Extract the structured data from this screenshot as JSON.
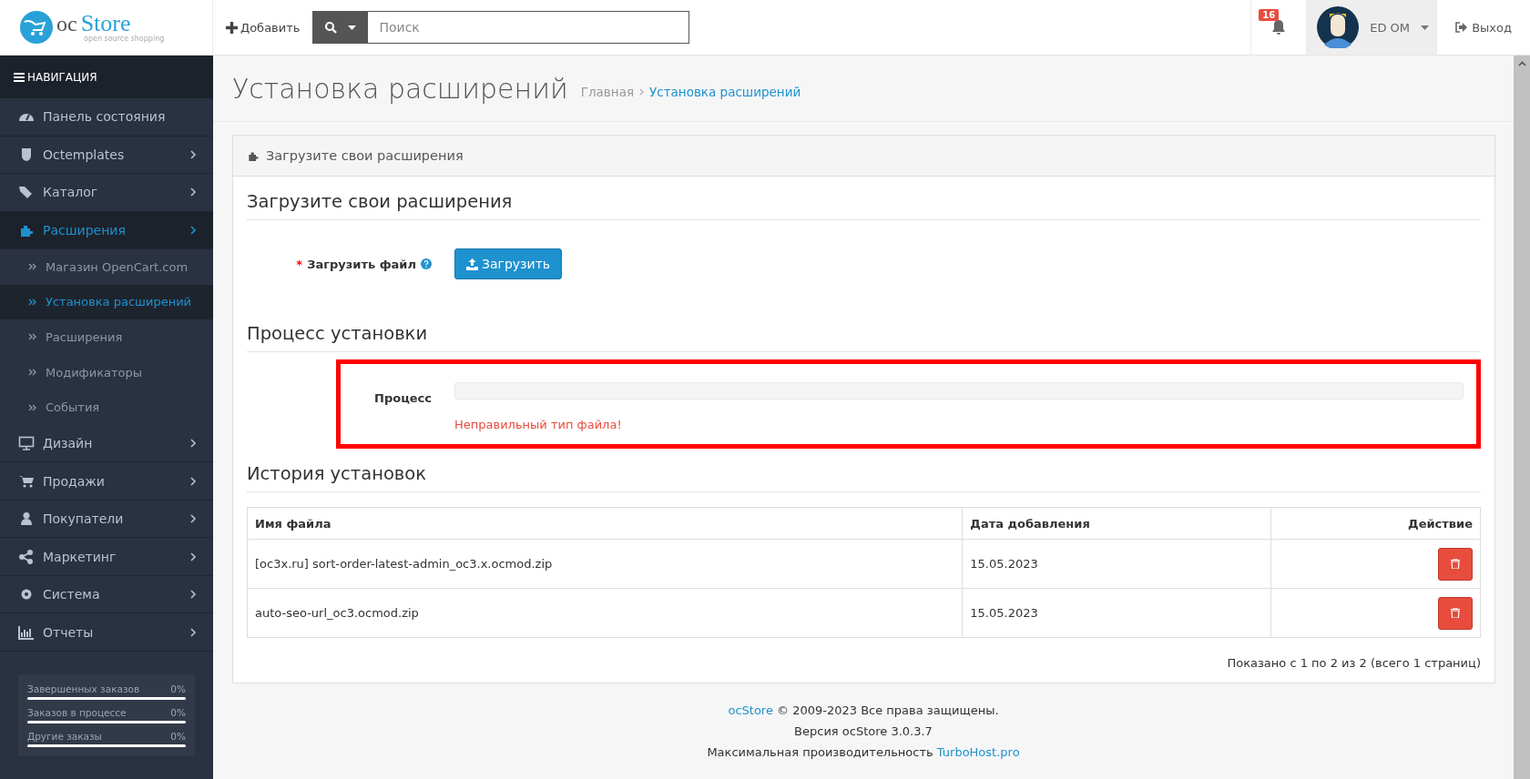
{
  "header": {
    "logo": {
      "text_1": "oc",
      "text_2": "Store",
      "tagline": "open source shopping"
    },
    "add_button": "Добавить",
    "search": {
      "placeholder": "Поиск"
    },
    "notifications": {
      "count": "16"
    },
    "user": {
      "name": "ED OM"
    },
    "logout": "Выход"
  },
  "sidebar": {
    "title": "НАВИГАЦИЯ",
    "items": [
      {
        "label": "Панель состояния",
        "selected": false,
        "has_arrow": false
      },
      {
        "label": "Octemplates",
        "selected": false,
        "has_arrow": true
      },
      {
        "label": "Каталог",
        "selected": false,
        "has_arrow": true
      },
      {
        "label": "Расширения",
        "selected": true,
        "has_arrow": true,
        "children": [
          {
            "label": "Магазин OpenCart.com",
            "selected": false
          },
          {
            "label": "Установка расширений",
            "selected": true
          },
          {
            "label": "Расширения",
            "selected": false
          },
          {
            "label": "Модификаторы",
            "selected": false
          },
          {
            "label": "События",
            "selected": false
          }
        ]
      },
      {
        "label": "Дизайн",
        "selected": false,
        "has_arrow": true
      },
      {
        "label": "Продажи",
        "selected": false,
        "has_arrow": true
      },
      {
        "label": "Покупатели",
        "selected": false,
        "has_arrow": true
      },
      {
        "label": "Маркетинг",
        "selected": false,
        "has_arrow": true
      },
      {
        "label": "Система",
        "selected": false,
        "has_arrow": true
      },
      {
        "label": "Отчеты",
        "selected": false,
        "has_arrow": true
      }
    ],
    "stats": [
      {
        "label": "Завершенных заказов",
        "reading": "0%",
        "level": 0
      },
      {
        "label": "Заказов в процессе",
        "reading": "0%",
        "level": 0
      },
      {
        "label": "Другие заказы",
        "reading": "0%",
        "level": 0
      }
    ]
  },
  "page": {
    "title": "Установка расширений",
    "breadcrumb": [
      {
        "label": "Главная",
        "current": false
      },
      {
        "label": "Установка расширений",
        "current": true
      }
    ],
    "panel": {
      "heading": "Загрузите свои расширения",
      "upload_section": {
        "title": "Загрузите свои расширения",
        "field_label": "Загрузить файл",
        "required_mark": "*",
        "button": "Загрузить"
      },
      "process_section": {
        "title": "Процесс установки",
        "label": "Процесс",
        "level": 0,
        "error": "Неправильный тип файла!",
        "highlighted": true
      },
      "history": {
        "title": "История установок",
        "columns": [
          "Имя файла",
          "Дата добавления",
          "Действие"
        ],
        "rows": [
          {
            "file": "[oc3x.ru] sort-order-latest-admin_oc3.x.ocmod.zip",
            "date": "15.05.2023"
          },
          {
            "file": "auto-seo-url_oc3.ocmod.zip",
            "date": "15.05.2023"
          }
        ],
        "pagination": "Показано с 1 по 2 из 2 (всего 1 страниц)"
      }
    }
  },
  "footer": {
    "brand": "ocStore",
    "copyright": "© 2009-2023 Все права защищены.",
    "version": "Версия ocStore 3.0.3.7",
    "perf_text": "Максимальная производительность",
    "perf_link": "TurboHost.pro"
  }
}
